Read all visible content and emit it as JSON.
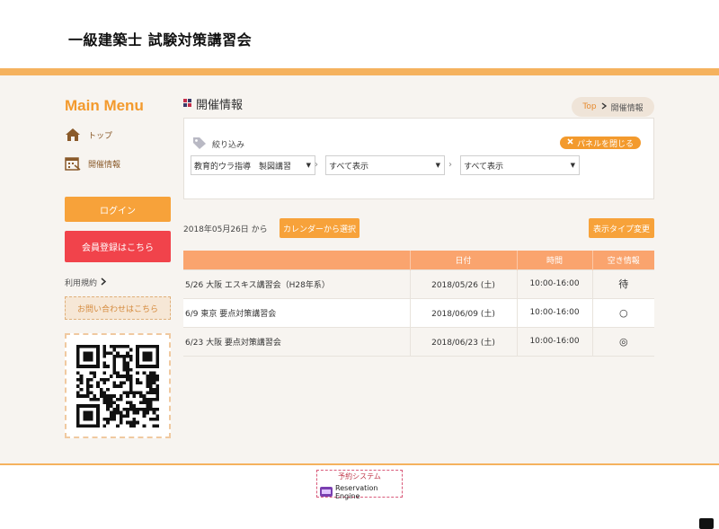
{
  "site": {
    "title": "一級建築士 試験対策講習会"
  },
  "sidebar": {
    "menu_title": "Main Menu",
    "items": [
      {
        "label": "トップ",
        "icon": "home-icon"
      },
      {
        "label": "開催情報",
        "icon": "calendar-icon"
      }
    ],
    "login_label": "ログイン",
    "register_label": "会員登録はこちら",
    "terms_label": "利用規約",
    "contact_label": "お問い合わせはこちら"
  },
  "content": {
    "section_title": "開催情報",
    "breadcrumb": {
      "top": "Top",
      "current": "開催情報"
    },
    "filter": {
      "label": "絞り込み",
      "close_label": "パネルを閉じる",
      "selects": [
        "教育的ウラ指導　製図講習",
        "すべて表示",
        "すべて表示"
      ]
    },
    "date_text": "2018年05月26日 から",
    "calendar_button": "カレンダーから選択",
    "display_type_button": "表示タイプ変更",
    "table": {
      "headers": [
        "",
        "日付",
        "時間",
        "空き情報"
      ],
      "rows": [
        {
          "name": "5/26 大阪 エスキス講習会（H28年系）",
          "date": "2018/05/26 (土)",
          "time": "10:00-16:00",
          "status": "待"
        },
        {
          "name": "6/9 東京 要点対策講習会",
          "date": "2018/06/09 (土)",
          "time": "10:00-16:00",
          "status": "○"
        },
        {
          "name": "6/23 大阪 要点対策講習会",
          "date": "2018/06/23 (土)",
          "time": "10:00-16:00",
          "status": "◎"
        }
      ]
    }
  },
  "footer": {
    "caption": "予約システム",
    "brand": "Reservation Engine"
  },
  "colors": {
    "accent": "#f5b25e",
    "button": "#f7a23a",
    "register": "#f1434b",
    "table_header": "#faa46e"
  }
}
